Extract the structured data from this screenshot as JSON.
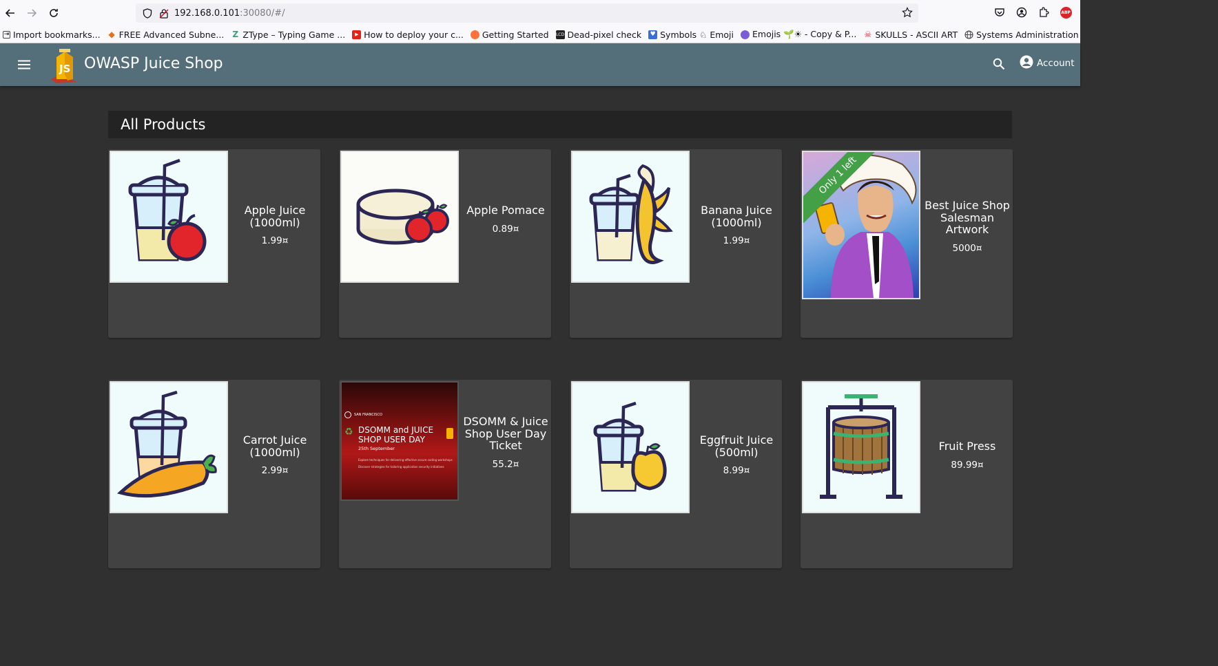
{
  "browser": {
    "url_host": "192.168.0.101",
    "url_rest": ":30080/#/",
    "bookmarks": [
      {
        "label": "Import bookmarks...",
        "icon": "import-icon",
        "color": "#444"
      },
      {
        "label": "FREE Advanced Subne...",
        "icon": "subnet-icon",
        "color": "#e76f1c"
      },
      {
        "label": "ZType – Typing Game ...",
        "icon": "ztype-icon",
        "color": "#3aa07a"
      },
      {
        "label": "How to deploy your c...",
        "icon": "youtube-icon",
        "color": "#e62117"
      },
      {
        "label": "Getting Started",
        "icon": "firefox-icon",
        "color": "#ff7139"
      },
      {
        "label": "Dead-pixel check",
        "icon": "lcd-icon",
        "color": "#222"
      },
      {
        "label": "Symbols ♘ Emoji",
        "icon": "symbols-icon",
        "color": "#3a6fd8"
      },
      {
        "label": "Emojis 🌱☀ - Copy & P...",
        "icon": "emojis-icon",
        "color": "#7b5bd6"
      },
      {
        "label": "SKULLS - ASCII ART",
        "icon": "skull-icon",
        "color": "#d9242b"
      },
      {
        "label": "Systems Administration",
        "icon": "globe-icon",
        "color": "#444"
      }
    ]
  },
  "app": {
    "title": "OWASP Juice Shop",
    "account_label": "Account"
  },
  "main": {
    "section_title": "All Products",
    "products": [
      {
        "name": "Apple Juice (1000ml)",
        "price": "1.99¤",
        "image": "apple-juice-image"
      },
      {
        "name": "Apple Pomace",
        "price": "0.89¤",
        "image": "apple-pomace-image"
      },
      {
        "name": "Banana Juice (1000ml)",
        "price": "1.99¤",
        "image": "banana-juice-image"
      },
      {
        "name": "Best Juice Shop Salesman Artwork",
        "price": "5000¤",
        "image": "salesman-artwork-image",
        "badge": "Only 1 left"
      },
      {
        "name": "Carrot Juice (1000ml)",
        "price": "2.99¤",
        "image": "carrot-juice-image"
      },
      {
        "name": "DSOMM & Juice Shop User Day Ticket",
        "price": "55.2¤",
        "image": "dsomm-ticket-image",
        "ticket": {
          "header": "SAN FRANCISCO",
          "title": "DSOMM and JUICE SHOP USER DAY",
          "date": "25th September",
          "line1": "Explore techniques for delivering effective secure coding workshops",
          "line2": "Discover strategies for tailoring application security initiatives"
        }
      },
      {
        "name": "Eggfruit Juice (500ml)",
        "price": "8.99¤",
        "image": "eggfruit-juice-image"
      },
      {
        "name": "Fruit Press",
        "price": "89.99¤",
        "image": "fruit-press-image"
      }
    ]
  }
}
